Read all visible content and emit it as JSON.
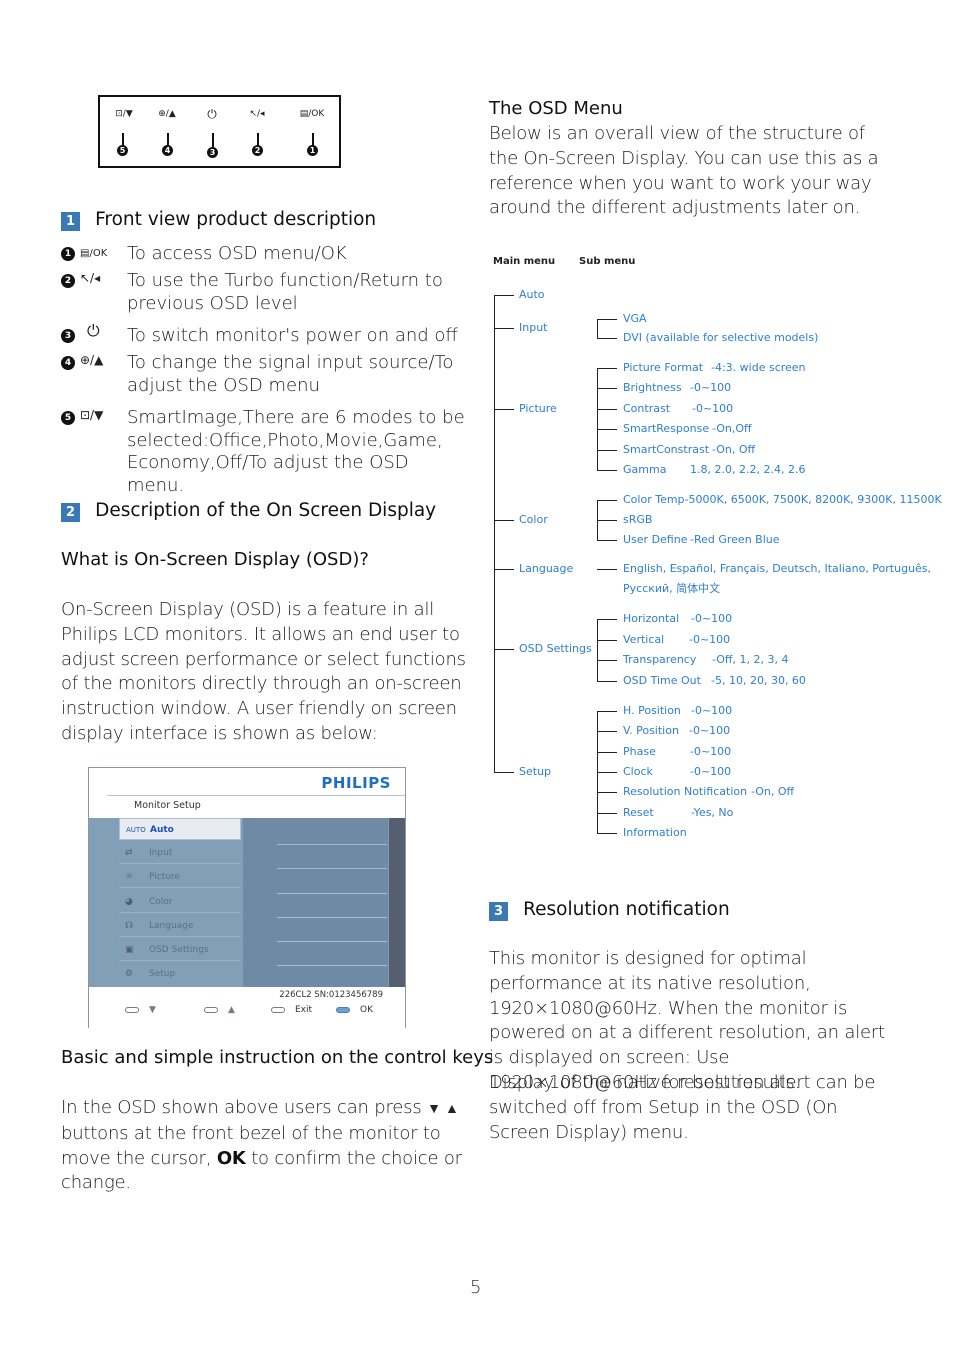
{
  "bezel": {
    "buttons": [
      {
        "num": "5",
        "icon": "smartimage-down",
        "label": "⊡/▼"
      },
      {
        "num": "4",
        "icon": "input-up",
        "label": "⊕/▲"
      },
      {
        "num": "3",
        "icon": "power",
        "label": "⏻"
      },
      {
        "num": "2",
        "icon": "turbo-back",
        "label": "↖/◂"
      },
      {
        "num": "1",
        "icon": "menu-ok",
        "label": "▤/OK"
      }
    ]
  },
  "section1": {
    "badge": "1",
    "title": "Front view product description",
    "keys": [
      {
        "num": "1",
        "icon": "▤/OK",
        "text": "To access OSD menu/OK"
      },
      {
        "num": "2",
        "icon": "↖/◂",
        "text": "To use the Turbo function/Return to previous OSD level"
      },
      {
        "num": "3",
        "icon": "⏻",
        "text": "To switch monitor's power on and off"
      },
      {
        "num": "4",
        "icon": "⊕/▲",
        "text": "To change the signal input source/To adjust the OSD menu"
      },
      {
        "num": "5",
        "icon": "⊡/▼",
        "text": "SmartImage,There are 6 modes to be selected:Office,Photo,Movie,Game, Economy,Off/To adjust the OSD menu."
      }
    ]
  },
  "section2": {
    "badge": "2",
    "title": "Description of the On Screen Display",
    "subtitle": "What is On-Screen Display (OSD)?",
    "paragraph": "On-Screen Display (OSD) is a feature in all Philips LCD monitors. It allows an end user to adjust screen performance or select functions of the monitors directly through an on-screen instruction window. A user friendly on screen display interface is shown as below:",
    "keys_title": "Basic and simple instruction on the control keys",
    "keys_text_1": "In the OSD shown above users can press",
    "keys_arrows": "▼ ▲",
    "keys_text_2": "buttons at the front bezel of the monitor to move the cursor,",
    "keys_ok": "OK",
    "keys_text_3": "to confirm the choice or change."
  },
  "osd": {
    "brand": "PHILIPS",
    "title": "Monitor Setup",
    "items": [
      {
        "icon": "AUTO",
        "label": "Auto",
        "selected": true
      },
      {
        "icon": "⇄",
        "label": "Input"
      },
      {
        "icon": "☼",
        "label": "Picture"
      },
      {
        "icon": "◕",
        "label": "Color"
      },
      {
        "icon": "☊",
        "label": "Language"
      },
      {
        "icon": "▣",
        "label": "OSD Settings"
      },
      {
        "icon": "⚙",
        "label": "Setup"
      }
    ],
    "serial": "226CL2 SN:0123456789",
    "footer": [
      {
        "label": "▼"
      },
      {
        "label": "▲"
      },
      {
        "label": "Exit"
      },
      {
        "label": "OK"
      }
    ]
  },
  "osd_menu": {
    "title": "The OSD Menu",
    "intro": "Below is an overall view of the structure of the On-Screen Display. You can use this as a reference when you want to work your way around the different adjustments later on.",
    "main_header": "Main menu",
    "sub_header": "Sub menu",
    "tree": [
      {
        "main": "Auto",
        "subs": []
      },
      {
        "main": "Input",
        "subs": [
          {
            "name": "VGA",
            "value": ""
          },
          {
            "name": "DVI (available for selective models)",
            "value": ""
          }
        ]
      },
      {
        "main": "Picture",
        "subs": [
          {
            "name": "Picture Format",
            "value": "-4:3. wide screen"
          },
          {
            "name": "Brightness",
            "value": "-0~100"
          },
          {
            "name": "Contrast",
            "value": "-0~100"
          },
          {
            "name": "SmartResponse",
            "value": "-On,Off"
          },
          {
            "name": "SmartConstrast",
            "value": "-On, Off"
          },
          {
            "name": "Gamma",
            "value": "1.8, 2.0, 2.2, 2.4, 2.6"
          }
        ]
      },
      {
        "main": "Color",
        "subs": [
          {
            "name": "Color Temp-5000K, 6500K, 7500K, 8200K, 9300K, 11500K",
            "value": ""
          },
          {
            "name": "sRGB",
            "value": ""
          },
          {
            "name": "User Define",
            "value": "-Red Green Blue"
          }
        ]
      },
      {
        "main": "Language",
        "subs": [
          {
            "name": "English, Español, Français, Deutsch, Italiano, Português,",
            "value": ""
          },
          {
            "name": "Русский, 简体中文",
            "value": ""
          }
        ]
      },
      {
        "main": "OSD Settings",
        "subs": [
          {
            "name": "Horizontal",
            "value": "-0~100"
          },
          {
            "name": "Vertical",
            "value": "-0~100"
          },
          {
            "name": "Transparency",
            "value": "-Off, 1, 2, 3, 4"
          },
          {
            "name": "OSD Time Out",
            "value": "-5, 10, 20, 30, 60"
          }
        ]
      },
      {
        "main": "Setup",
        "subs": [
          {
            "name": "H. Position",
            "value": "-0~100"
          },
          {
            "name": "V. Position",
            "value": "-0~100"
          },
          {
            "name": "Phase",
            "value": "-0~100"
          },
          {
            "name": "Clock",
            "value": "-0~100"
          },
          {
            "name": "Resolution Notification",
            "value": "-On, Off"
          },
          {
            "name": "Reset",
            "value": "-Yes, No"
          },
          {
            "name": "Information",
            "value": ""
          }
        ]
      }
    ]
  },
  "section3": {
    "badge": "3",
    "title": "Resolution notification",
    "paragraph_1": "This monitor is designed for optimal performance at its native resolution, 1920×1080@60Hz. When the monitor is powered on at a different resolution, an alert is displayed on screen: Use 1920×1080@60Hz for best results.",
    "paragraph_2": "Display of the native resolution alert can be switched off from Setup in the OSD (On Screen Display) menu."
  },
  "page_number": "5"
}
